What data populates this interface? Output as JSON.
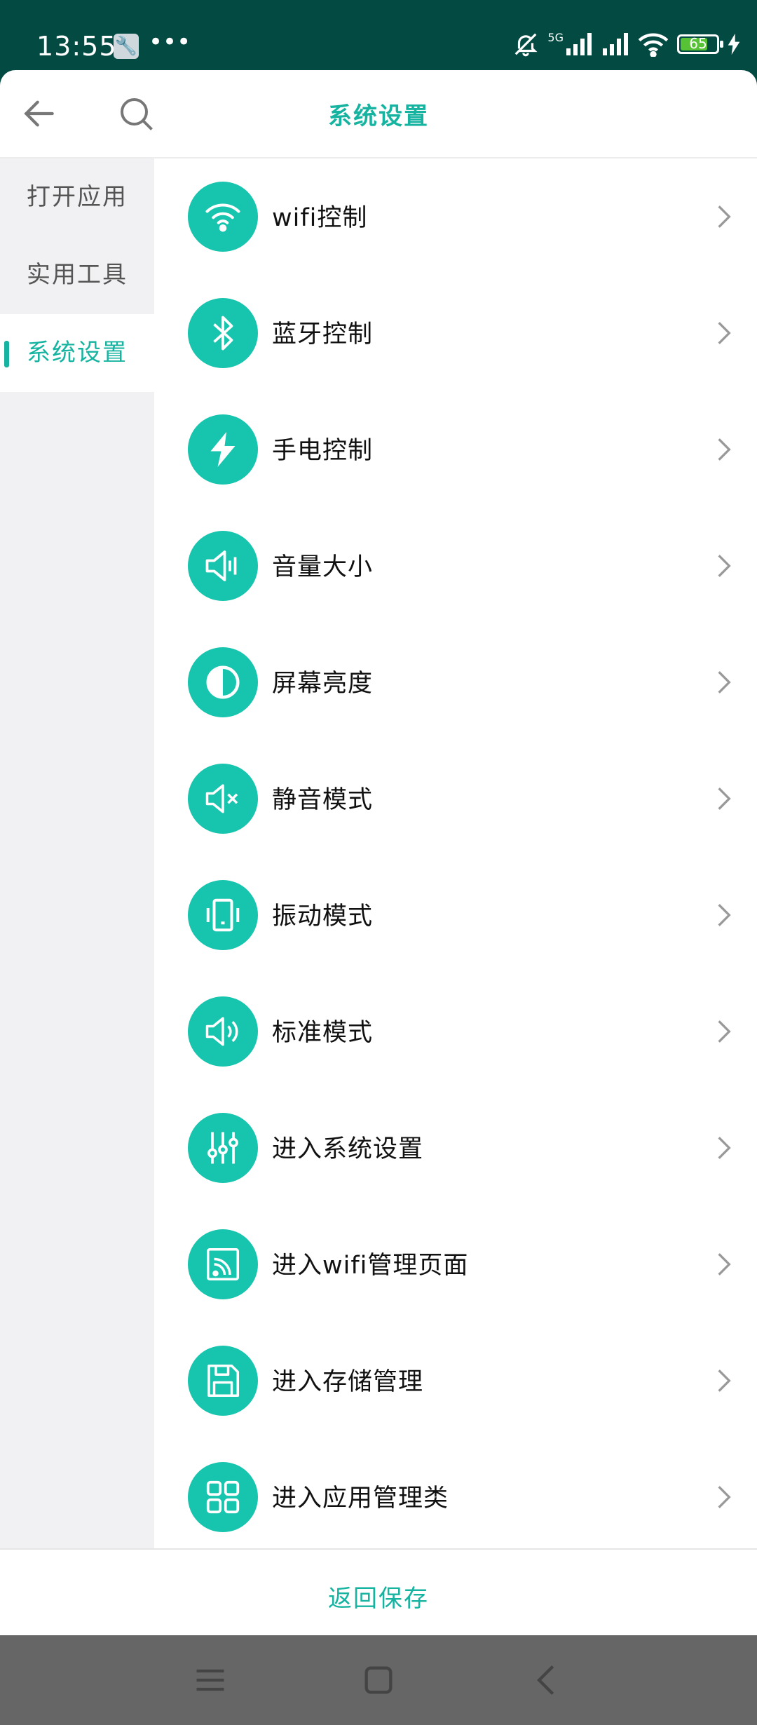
{
  "status_bar": {
    "time": "13:55",
    "dots": "•••",
    "battery_level": "65",
    "network": "5G"
  },
  "header": {
    "title": "系统设置"
  },
  "sidebar": {
    "items": [
      {
        "label": "打开应用"
      },
      {
        "label": "实用工具"
      },
      {
        "label": "系统设置"
      }
    ]
  },
  "settings": {
    "items": [
      {
        "label": "wifi控制",
        "icon": "wifi-icon"
      },
      {
        "label": "蓝牙控制",
        "icon": "bluetooth-icon"
      },
      {
        "label": "手电控制",
        "icon": "flashlight-icon"
      },
      {
        "label": "音量大小",
        "icon": "volume-icon"
      },
      {
        "label": "屏幕亮度",
        "icon": "brightness-icon"
      },
      {
        "label": "静音模式",
        "icon": "mute-icon"
      },
      {
        "label": "振动模式",
        "icon": "vibrate-icon"
      },
      {
        "label": "标准模式",
        "icon": "sound-icon"
      },
      {
        "label": "进入系统设置",
        "icon": "sliders-icon"
      },
      {
        "label": "进入wifi管理页面",
        "icon": "cast-icon"
      },
      {
        "label": "进入存储管理",
        "icon": "save-icon"
      },
      {
        "label": "进入应用管理类",
        "icon": "grid-icon"
      }
    ]
  },
  "footer": {
    "button_label": "返回保存"
  },
  "colors": {
    "accent": "#15b3a0",
    "status_bar": "#024a42",
    "icon_circle": "#17c4ad"
  }
}
